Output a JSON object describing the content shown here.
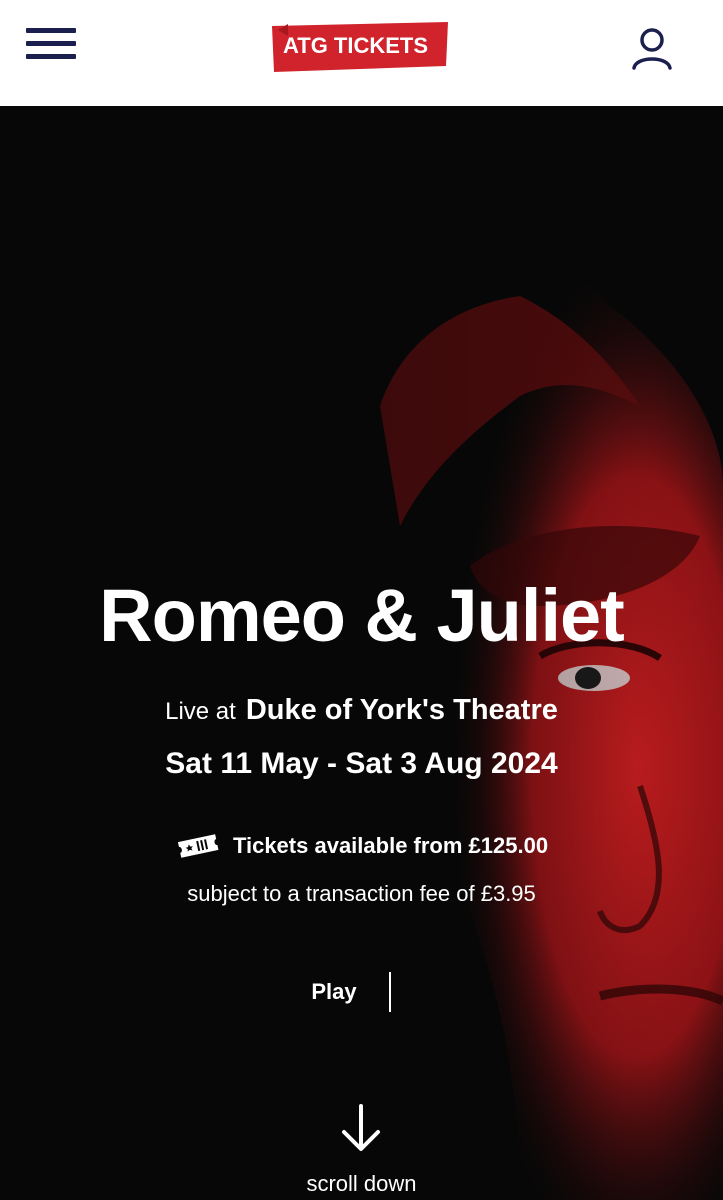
{
  "header": {
    "logo_text": "ATG TICKETS",
    "menu_icon": "hamburger-menu-icon",
    "account_icon": "user-account-icon"
  },
  "show": {
    "title": "Romeo & Juliet",
    "venue_prefix": "Live at",
    "venue": "Duke of York's Theatre",
    "dates": "Sat 11 May - Sat 3 Aug 2024",
    "tickets_text": "Tickets available from £125.00",
    "fee_text": "subject to a transaction fee of £3.95",
    "genre": "Play",
    "scroll_label": "scroll down"
  },
  "colors": {
    "brand_red": "#d0232b",
    "header_bg": "#ffffff",
    "icon_navy": "#1b1f4d",
    "hero_bg": "#070707",
    "hero_red": "#b01a1c"
  }
}
